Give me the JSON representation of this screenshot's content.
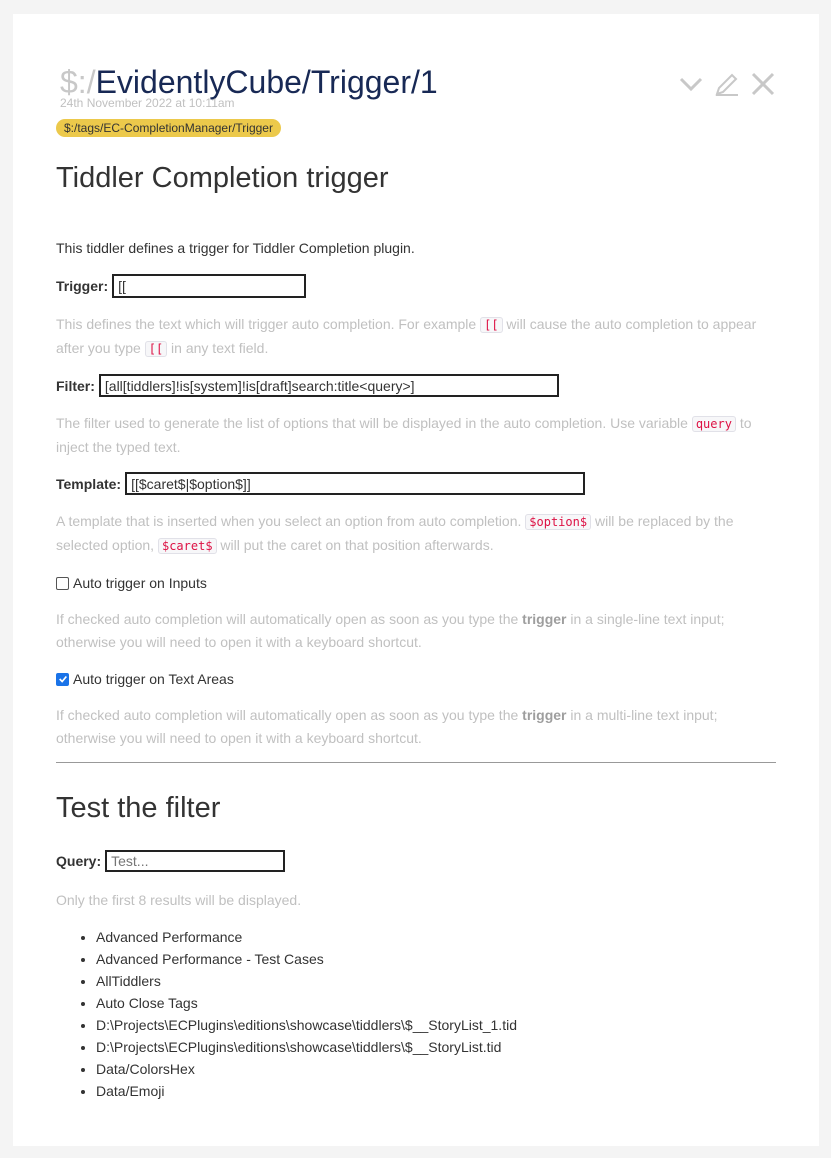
{
  "tiddler": {
    "title_prefix": "$:/",
    "title_main": "EvidentlyCube/Trigger/1",
    "subtitle": "24th November 2022 at 10:11am",
    "tag": "$:/tags/EC-CompletionManager/Trigger",
    "controls": [
      "chevron-down-icon",
      "edit-icon",
      "close-icon"
    ]
  },
  "section1": {
    "heading": "Tiddler Completion trigger",
    "intro": "This tiddler defines a trigger for Tiddler Completion plugin.",
    "trigger_label": "Trigger:",
    "trigger_value": "[[",
    "trigger_help_a": "This defines the text which will trigger auto completion. For example ",
    "trigger_help_code1": "[[",
    "trigger_help_b": " will cause the auto completion to appear after you type ",
    "trigger_help_code2": "[[",
    "trigger_help_c": " in any text field.",
    "filter_label": "Filter:",
    "filter_value": "[all[tiddlers]!is[system]!is[draft]search:title<query>]",
    "filter_help_a": "The filter used to generate the list of options that will be displayed in the auto completion. Use variable ",
    "filter_help_code": "query",
    "filter_help_b": " to inject the typed text.",
    "template_label": "Template:",
    "template_value": "[[$caret$|$option$]]",
    "template_help_a": "A template that is inserted when you select an option from auto completion. ",
    "template_help_code1": "$option$",
    "template_help_b": " will be replaced by the selected option, ",
    "template_help_code2": "$caret$",
    "template_help_c": " will put the caret on that position afterwards.",
    "auto_inputs_label": "Auto trigger on Inputs",
    "auto_inputs_checked": false,
    "auto_inputs_help_a": "If checked auto completion will automatically open as soon as you type the ",
    "auto_inputs_help_bold": "trigger",
    "auto_inputs_help_b": " in a single-line text input; otherwise you will need to open it with a keyboard shortcut.",
    "auto_textareas_label": "Auto trigger on Text Areas",
    "auto_textareas_checked": true,
    "auto_textareas_help_a": "If checked auto completion will automatically open as soon as you type the ",
    "auto_textareas_help_bold": "trigger",
    "auto_textareas_help_b": " in a multi-line text input; otherwise you will need to open it with a keyboard shortcut."
  },
  "section2": {
    "heading": "Test the filter",
    "query_label": "Query:",
    "query_placeholder": "Test...",
    "query_value": "",
    "results_note": "Only the first 8 results will be displayed.",
    "results": [
      "Advanced Performance",
      "Advanced Performance - Test Cases",
      "AllTiddlers",
      "Auto Close Tags",
      "D:\\Projects\\ECPlugins\\editions\\showcase\\tiddlers\\$__StoryList_1.tid",
      "D:\\Projects\\ECPlugins\\editions\\showcase\\tiddlers\\$__StoryList.tid",
      "Data/ColorsHex",
      "Data/Emoji"
    ]
  },
  "colors": {
    "title": "#182955",
    "tag_bg": "#ecc94b",
    "muted_text": "#c0c0c0",
    "code_text": "#dd1144",
    "checkbox_checked": "#1a73e8"
  }
}
